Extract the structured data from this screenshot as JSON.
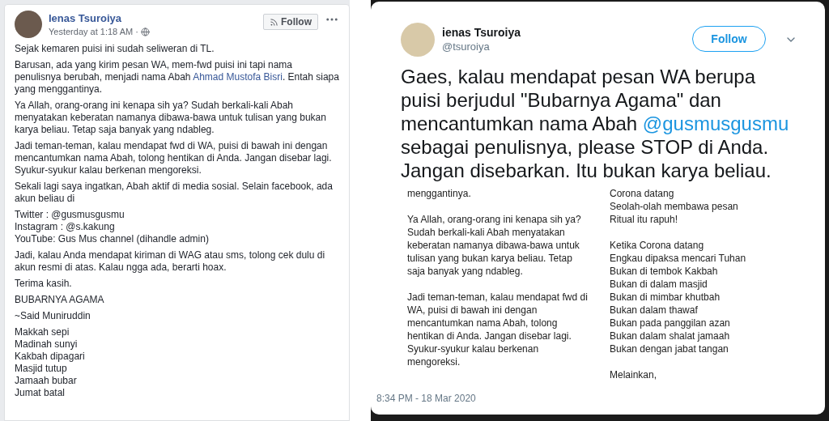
{
  "facebook_post": {
    "author": "Ienas Tsuroiya",
    "time": "Yesterday at 1:18 AM ·",
    "follow_button": "Follow",
    "paragraphs": [
      {
        "kind": "text",
        "text": "Sejak kemaren puisi ini sudah seliweran di TL."
      },
      {
        "kind": "link_text",
        "before": "Barusan, ada yang kirim pesan WA, mem-fwd puisi ini tapi nama penulisnya berubah, menjadi nama Abah ",
        "link": "Ahmad Mustofa Bisri",
        "after": ". Entah siapa yang menggantinya."
      },
      {
        "kind": "text",
        "text": "Ya Allah, orang-orang ini kenapa sih ya? Sudah berkali-kali Abah menyatakan keberatan namanya dibawa-bawa untuk tulisan yang bukan karya beliau. Tetap saja banyak yang ndableg."
      },
      {
        "kind": "text",
        "text": "Jadi teman-teman, kalau mendapat fwd di WA, puisi di bawah ini dengan mencantumkan nama Abah, tolong hentikan di Anda. Jangan disebar lagi. Syukur-syukur kalau berkenan mengoreksi."
      },
      {
        "kind": "text",
        "text": "Sekali lagi saya ingatkan, Abah aktif di media sosial. Selain facebook, ada akun beliau di"
      },
      {
        "kind": "lines",
        "lines": [
          "Twitter : @gusmusgusmu",
          "Instagram : @s.kakung",
          "YouTube: Gus Mus channel (dihandle admin)"
        ]
      },
      {
        "kind": "text",
        "text": "Jadi, kalau Anda mendapat kiriman di WAG atau sms, tolong cek dulu di akun resmi di atas. Kalau ngga ada, berarti hoax."
      },
      {
        "kind": "text",
        "text": "Terima kasih."
      },
      {
        "kind": "text",
        "text": "BUBARNYA AGAMA"
      },
      {
        "kind": "text",
        "text": "~Said Muniruddin"
      },
      {
        "kind": "lines",
        "lines": [
          "Makkah sepi",
          "Madinah sunyi",
          "Kakbah dipagari",
          "Masjid tutup",
          "Jamaah bubar",
          "Jumat batal"
        ]
      }
    ]
  },
  "tweet": {
    "author": "ienas Tsuroiya",
    "handle": "@tsuroiya",
    "follow_button": "Follow",
    "text": {
      "before": "Gaes, kalau mendapat pesan WA berupa puisi berjudul \"Bubarnya Agama\" dan mencantumkan nama Abah ",
      "link": "@gusmusgusmu",
      "after": " sebagai penulisnya, please STOP di Anda. Jangan disebarkan. Itu bukan karya beliau."
    },
    "image_left": [
      "menggantinya.",
      "Ya Allah, orang-orang ini kenapa sih ya? Sudah berkali-kali Abah menyatakan keberatan namanya dibawa-bawa untuk tulisan yang bukan karya beliau. Tetap saja banyak yang ndableg.",
      "Jadi teman-teman, kalau mendapat fwd di WA, puisi di bawah ini dengan mencantumkan nama Abah, tolong hentikan di Anda. Jangan disebar lagi. Syukur-syukur kalau berkenan mengoreksi."
    ],
    "image_right": [
      [
        "Corona datang",
        "Seolah-olah membawa pesan",
        "Ritual itu rapuh!"
      ],
      [
        "Ketika Corona datang",
        "Engkau dipaksa mencari Tuhan",
        "Bukan di tembok Kakbah",
        "Bukan di dalam masjid",
        "Bukan di mimbar khutbah",
        "Bukan dalam thawaf",
        "Bukan pada panggilan azan",
        "Bukan dalam shalat jamaah",
        "Bukan dengan jabat tangan"
      ],
      [
        "Melainkan,"
      ]
    ],
    "timestamp": "8:34 PM - 18 Mar 2020"
  }
}
